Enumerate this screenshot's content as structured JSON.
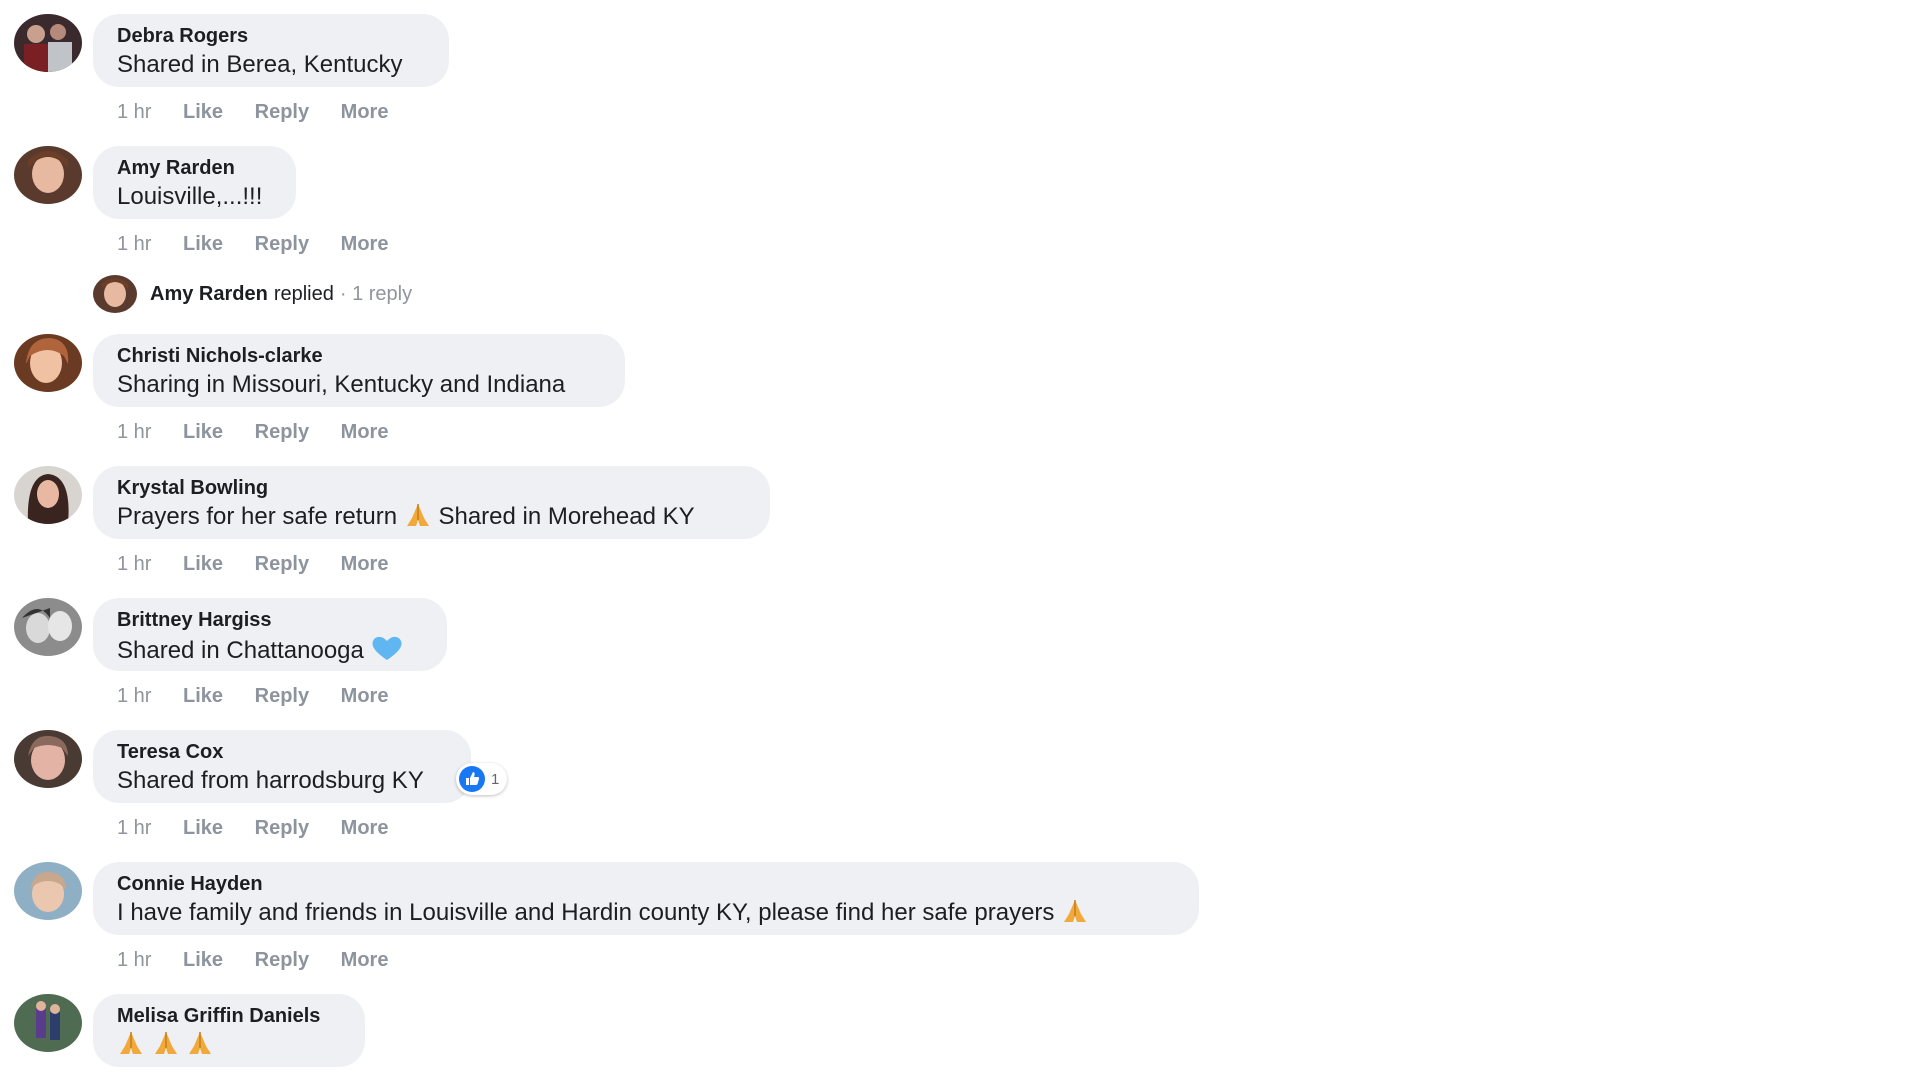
{
  "actions": {
    "time": "1 hr",
    "like": "Like",
    "reply": "Reply",
    "more": "More"
  },
  "replied_summary": {
    "name": "Amy Rarden",
    "text": "replied",
    "count": "· 1 reply",
    "avatar_icon": "user-avatar-icon"
  },
  "comments": [
    {
      "author": "Debra Rogers",
      "text": "Shared in Berea, Kentucky",
      "avatar_color": "#4a2e2e"
    },
    {
      "author": "Amy Rarden",
      "text": "Louisville,...!!!",
      "avatar_color": "#8a5a44"
    },
    {
      "author": "Christi Nichols-clarke",
      "text": "Sharing in Missouri, Kentucky and Indiana",
      "avatar_color": "#b0643c"
    },
    {
      "author": "Krystal Bowling",
      "text": "Prayers for her safe return",
      "text_after": "Shared in Morehead KY",
      "emoji_icon": "folded-hands-icon",
      "avatar_color": "#5a3a32"
    },
    {
      "author": "Brittney Hargiss",
      "text": "Shared in Chattanooga",
      "emoji_icon": "blue-heart-icon",
      "avatar_color": "#777777"
    },
    {
      "author": "Teresa Cox",
      "text": "Shared from harrodsburg KY",
      "reaction": {
        "icon": "like-reaction-icon",
        "count": "1"
      },
      "avatar_color": "#a7786a"
    },
    {
      "author": "Connie Hayden",
      "text": "I have family and friends in Louisville and Hardin county KY, please find her safe prayers",
      "emoji_icon": "folded-hands-icon",
      "avatar_color": "#8fa7b8"
    },
    {
      "author": "Melisa Griffin Daniels",
      "text": "",
      "emoji_icon": "folded-hands-icon",
      "emoji_count": 3,
      "avatar_color": "#4f6b52"
    }
  ],
  "colors": {
    "bubble": "#eef0f3",
    "meta": "#90949c",
    "like_blue": "#1877f2",
    "heart_blue": "#5fb6f0",
    "hands": "#f2a93b"
  }
}
